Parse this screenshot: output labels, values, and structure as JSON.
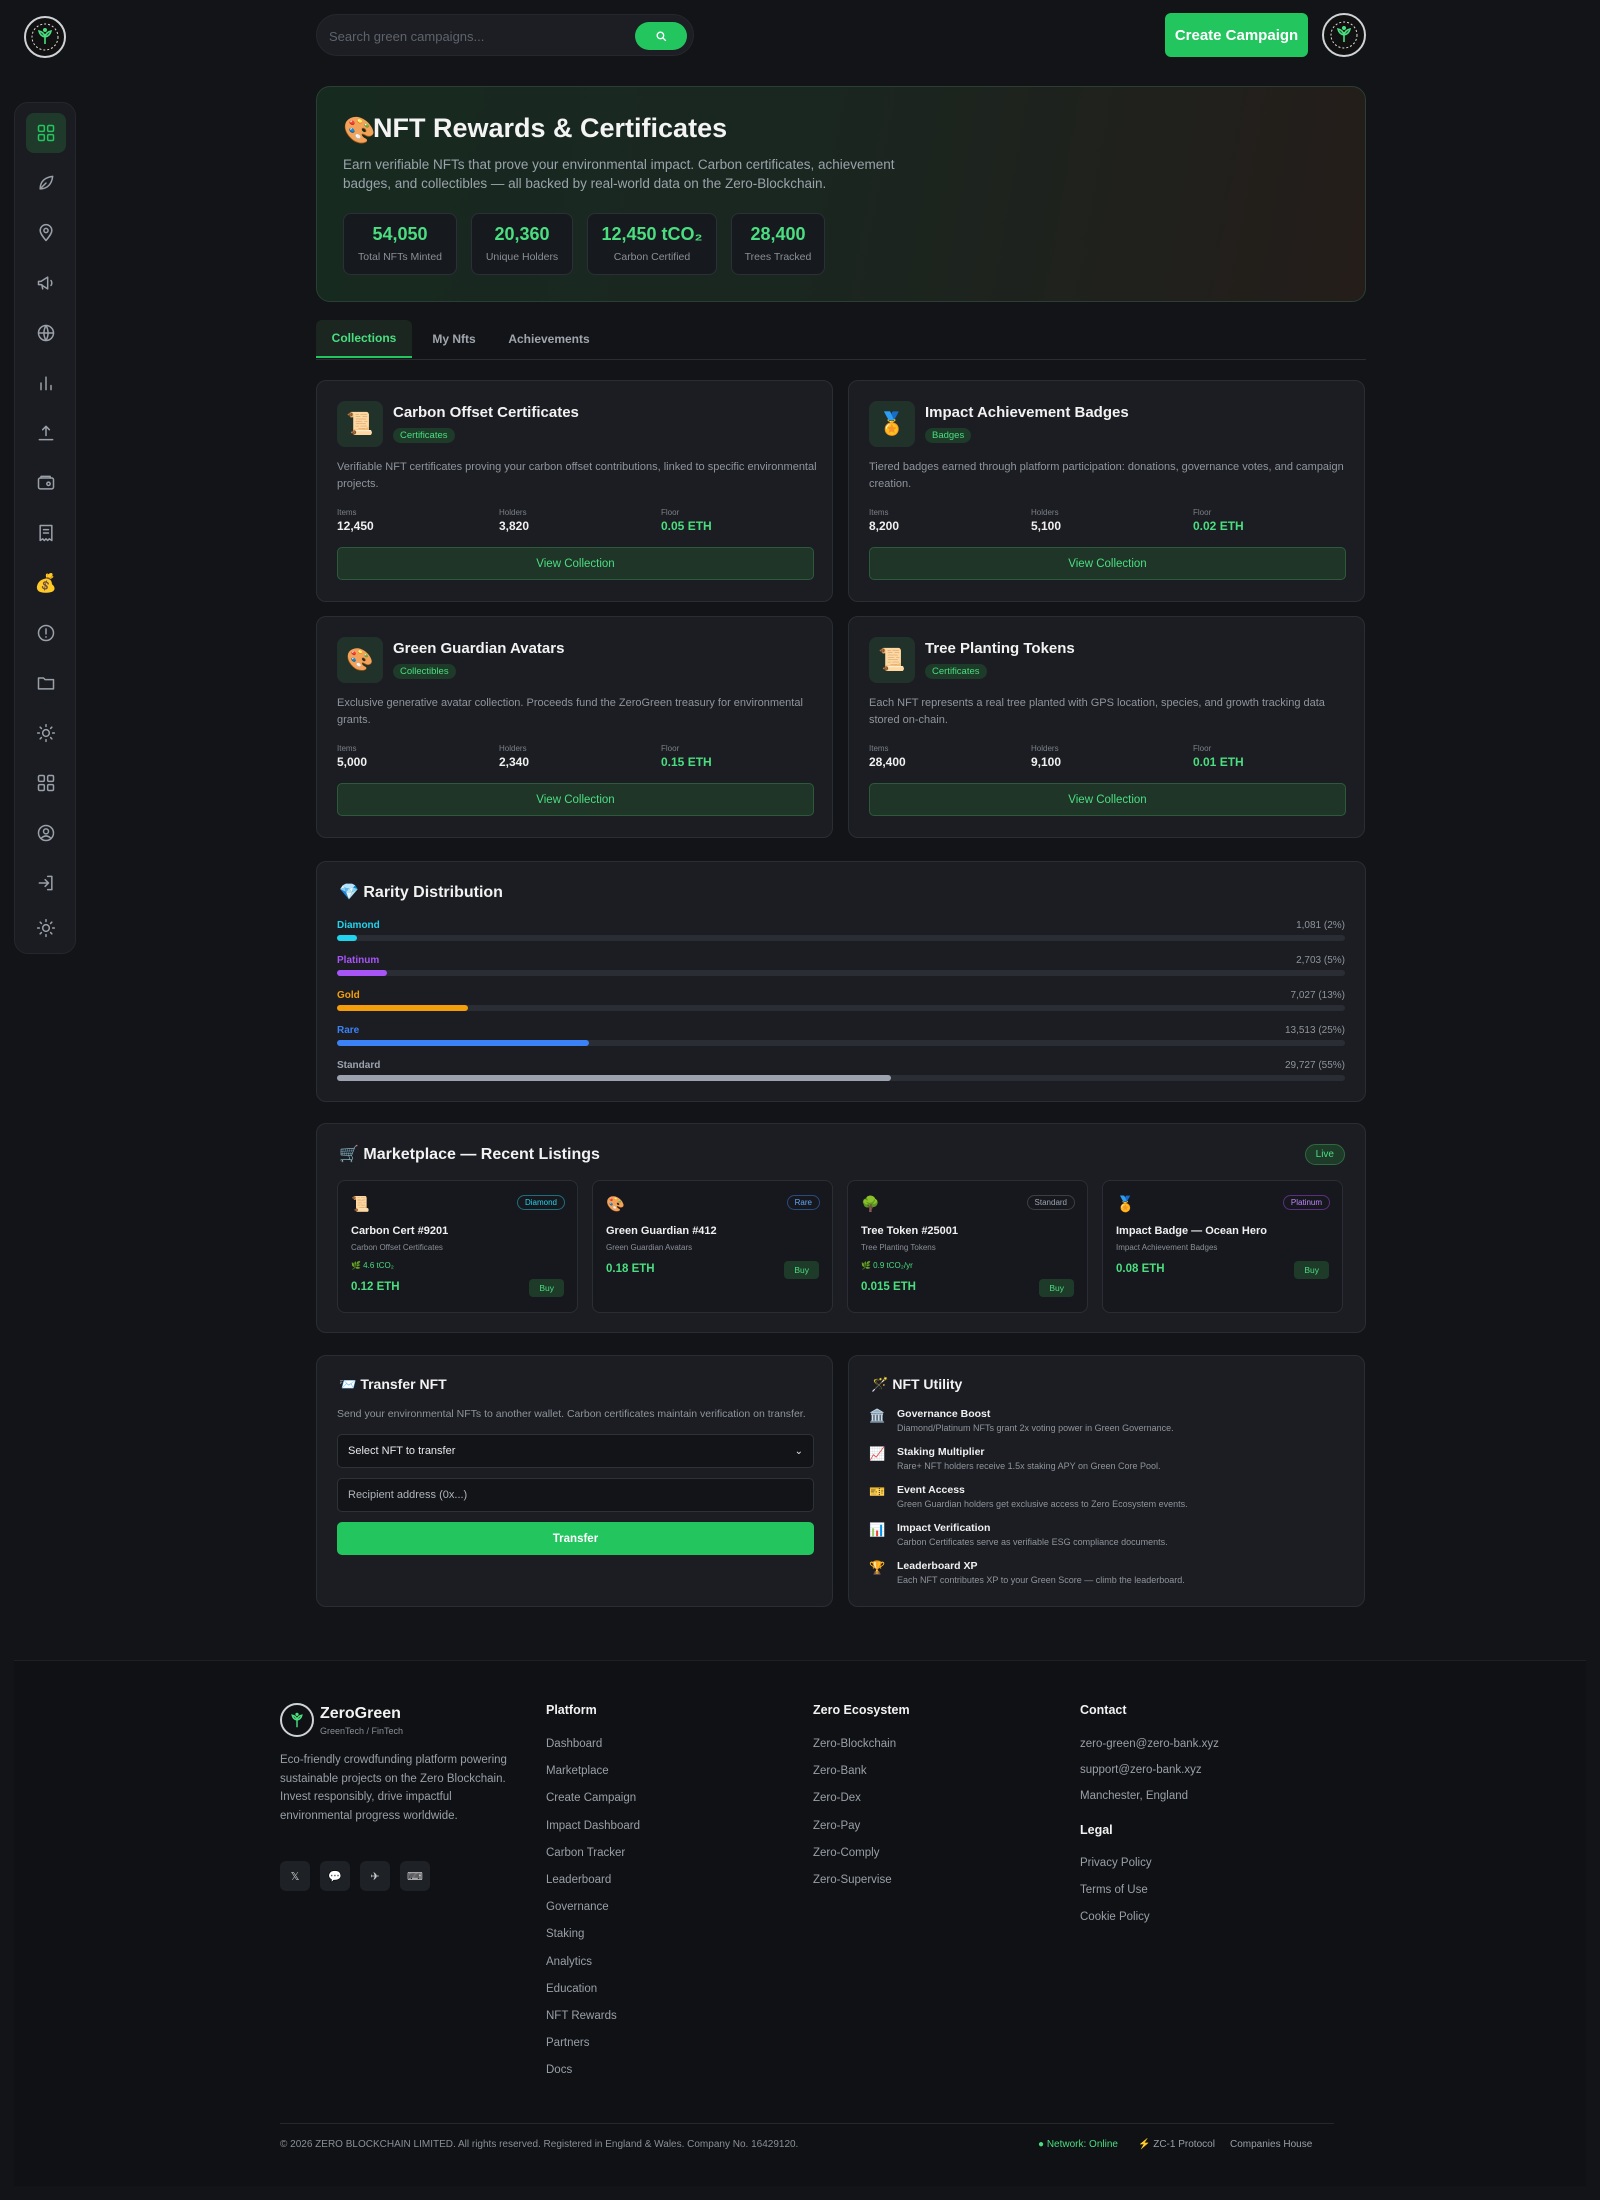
{
  "header": {
    "search_placeholder": "Search green campaigns...",
    "create_label": "Create Campaign"
  },
  "hero": {
    "emoji": "🎨",
    "title": "NFT Rewards & Certificates",
    "description": "Earn verifiable NFTs that prove your environmental impact. Carbon certificates, achievement badges, and collectibles — all backed by real-world data on the Zero-Blockchain.",
    "stats": [
      {
        "value": "54,050",
        "label": "Total NFTs Minted"
      },
      {
        "value": "20,360",
        "label": "Unique Holders"
      },
      {
        "value": "12,450 tCO₂",
        "label": "Carbon Certified"
      },
      {
        "value": "28,400",
        "label": "Trees Tracked"
      }
    ]
  },
  "tabs": [
    "Collections",
    "My Nfts",
    "Achievements"
  ],
  "collections": [
    {
      "icon": "📜",
      "title": "Carbon Offset Certificates",
      "tag": "Certificates",
      "desc": "Verifiable NFT certificates proving your carbon offset contributions, linked to specific environmental projects.",
      "items": "12,450",
      "holders": "3,820",
      "floor": "0.05 ETH",
      "button": "View Collection"
    },
    {
      "icon": "🏅",
      "title": "Impact Achievement Badges",
      "tag": "Badges",
      "desc": "Tiered badges earned through platform participation: donations, governance votes, and campaign creation.",
      "items": "8,200",
      "holders": "5,100",
      "floor": "0.02 ETH",
      "button": "View Collection"
    },
    {
      "icon": "🎨",
      "title": "Green Guardian Avatars",
      "tag": "Collectibles",
      "desc": "Exclusive generative avatar collection. Proceeds fund the ZeroGreen treasury for environmental grants.",
      "items": "5,000",
      "holders": "2,340",
      "floor": "0.15 ETH",
      "button": "View Collection"
    },
    {
      "icon": "📜",
      "title": "Tree Planting Tokens",
      "tag": "Certificates",
      "desc": "Each NFT represents a real tree planted with GPS location, species, and growth tracking data stored on-chain.",
      "items": "28,400",
      "holders": "9,100",
      "floor": "0.01 ETH",
      "button": "View Collection"
    }
  ],
  "stat_labels": {
    "items": "Items",
    "holders": "Holders",
    "floor": "Floor"
  },
  "rarity": {
    "icon": "💎",
    "title": "Rarity Distribution",
    "rows": [
      {
        "name": "Diamond",
        "value": "1,081 (2%)",
        "pct": 2,
        "color": "#22d3ee"
      },
      {
        "name": "Platinum",
        "value": "2,703 (5%)",
        "pct": 5,
        "color": "#a855f7"
      },
      {
        "name": "Gold",
        "value": "7,027 (13%)",
        "pct": 13,
        "color": "#f59e0b"
      },
      {
        "name": "Rare",
        "value": "13,513 (25%)",
        "pct": 25,
        "color": "#3b82f6"
      },
      {
        "name": "Standard",
        "value": "29,727 (55%)",
        "pct": 55,
        "color": "#9ca3af"
      }
    ]
  },
  "marketplace": {
    "icon": "🛒",
    "title": "Marketplace — Recent Listings",
    "live": "Live",
    "listings": [
      {
        "icon": "📜",
        "badge": "Diamond",
        "badge_color": "#22d3ee",
        "title": "Carbon Cert #9201",
        "collection": "Carbon Offset Certificates",
        "co2": "🌿 4.6 tCO₂",
        "price": "0.12 ETH",
        "buy": "Buy"
      },
      {
        "icon": "🎨",
        "badge": "Rare",
        "badge_color": "#3b82f6",
        "title": "Green Guardian #412",
        "collection": "Green Guardian Avatars",
        "co2": "",
        "price": "0.18 ETH",
        "buy": "Buy"
      },
      {
        "icon": "🌳",
        "badge": "Standard",
        "badge_color": "#9ca3af",
        "title": "Tree Token #25001",
        "collection": "Tree Planting Tokens",
        "co2": "🌿 0.9 tCO₂/yr",
        "price": "0.015 ETH",
        "buy": "Buy"
      },
      {
        "icon": "🏅",
        "badge": "Platinum",
        "badge_color": "#a855f7",
        "title": "Impact Badge — Ocean Hero",
        "collection": "Impact Achievement Badges",
        "co2": "",
        "price": "0.08 ETH",
        "buy": "Buy"
      }
    ]
  },
  "transfer": {
    "icon": "📨",
    "title": "Transfer NFT",
    "desc": "Send your environmental NFTs to another wallet. Carbon certificates maintain verification on transfer.",
    "select_value": "Select NFT to transfer",
    "recipient_placeholder": "Recipient address (0x...)",
    "button": "Transfer"
  },
  "utility": {
    "icon": "🪄",
    "title": "NFT Utility",
    "items": [
      {
        "icon": "🏛️",
        "title": "Governance Boost",
        "desc": "Diamond/Platinum NFTs grant 2x voting power in Green Governance."
      },
      {
        "icon": "📈",
        "title": "Staking Multiplier",
        "desc": "Rare+ NFT holders receive 1.5x staking APY on Green Core Pool."
      },
      {
        "icon": "🎫",
        "title": "Event Access",
        "desc": "Green Guardian holders get exclusive access to Zero Ecosystem events."
      },
      {
        "icon": "📊",
        "title": "Impact Verification",
        "desc": "Carbon Certificates serve as verifiable ESG compliance documents."
      },
      {
        "icon": "🏆",
        "title": "Leaderboard XP",
        "desc": "Each NFT contributes XP to your Green Score — climb the leaderboard."
      }
    ]
  },
  "footer": {
    "brand": "ZeroGreen",
    "tagline": "GreenTech / FinTech",
    "about": "Eco-friendly crowdfunding platform powering sustainable projects on the Zero Blockchain. Invest responsibly, drive impactful environmental progress worldwide.",
    "socials": [
      "𝕏",
      "💬",
      "✈",
      "⌨"
    ],
    "platform_title": "Platform",
    "platform": [
      "Dashboard",
      "Marketplace",
      "Create Campaign",
      "Impact Dashboard",
      "Carbon Tracker",
      "Leaderboard",
      "Governance",
      "Staking",
      "Analytics",
      "Education",
      "NFT Rewards",
      "Partners",
      "Docs"
    ],
    "eco_title": "Zero Ecosystem",
    "eco": [
      "Zero-Blockchain",
      "Zero-Bank",
      "Zero-Dex",
      "Zero-Pay",
      "Zero-Comply",
      "Zero-Supervise"
    ],
    "contact_title": "Contact",
    "contact": [
      "zero-green@zero-bank.xyz",
      "support@zero-bank.xyz",
      "Manchester, England"
    ],
    "legal_title": "Legal",
    "legal": [
      "Privacy Policy",
      "Terms of Use",
      "Cookie Policy"
    ],
    "copyright": "© 2026 ZERO BLOCKCHAIN LIMITED. All rights reserved. Registered in England & Wales. Company No. 16429120.",
    "network": "● Network: Online",
    "protocol": "⚡ ZC-1 Protocol",
    "companies": "Companies House"
  },
  "colors": {
    "accent": "#22c55e",
    "accent_light": "#4ade80",
    "bg": "#121418",
    "card": "#1b1d22"
  }
}
